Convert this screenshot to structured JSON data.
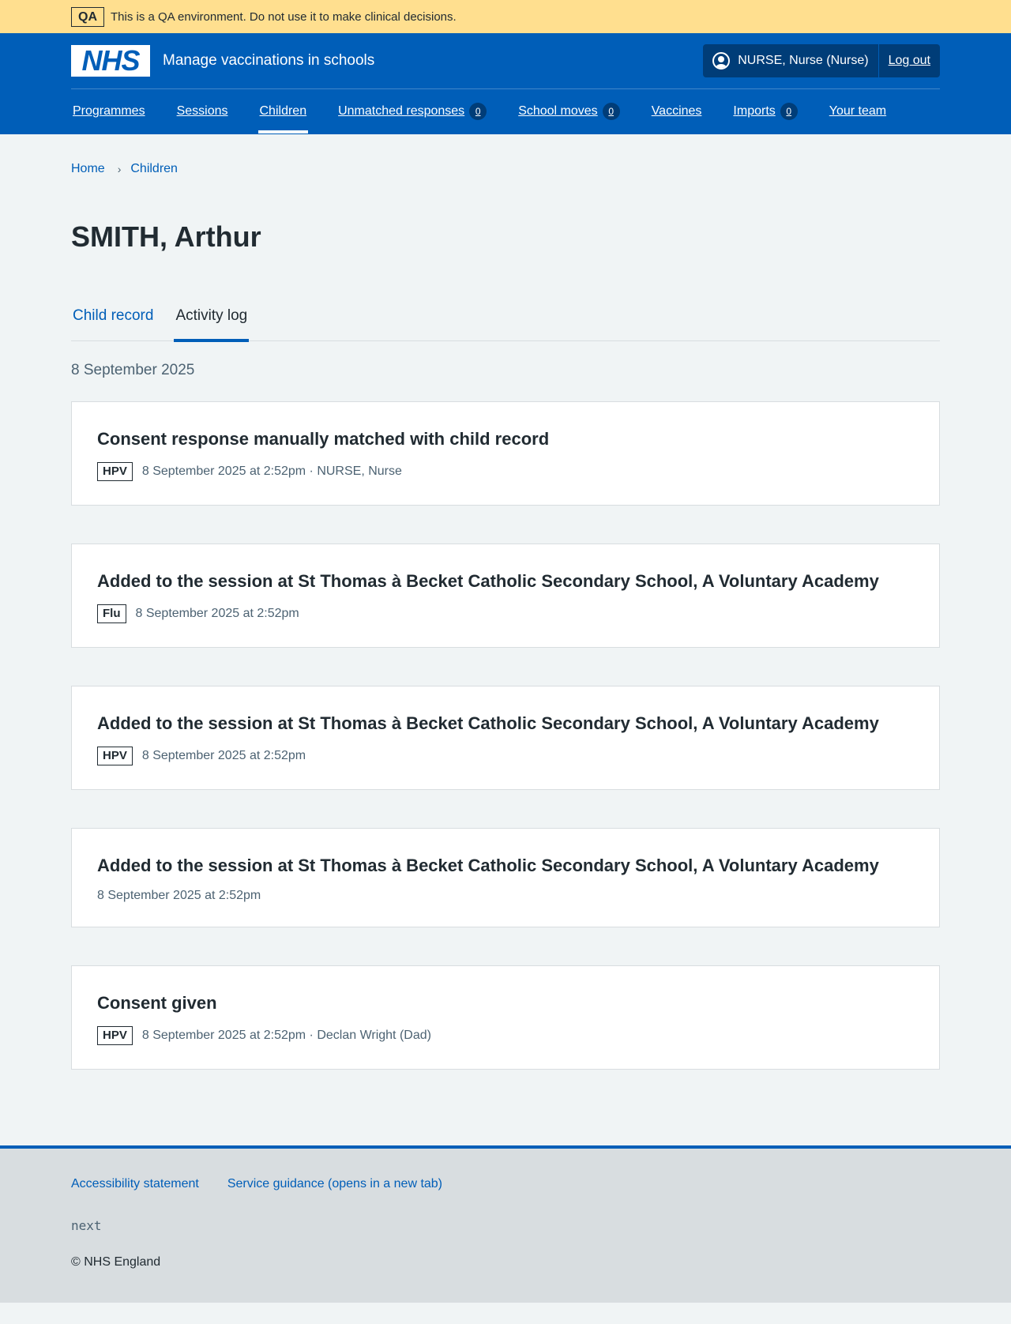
{
  "qa_banner": {
    "tag": "QA",
    "text": "This is a QA environment. Do not use it to make clinical decisions."
  },
  "header": {
    "logo_text": "NHS",
    "service_name": "Manage vaccinations in schools",
    "user_label": "NURSE, Nurse (Nurse)",
    "logout_label": "Log out"
  },
  "nav": {
    "programmes": "Programmes",
    "sessions": "Sessions",
    "children": "Children",
    "unmatched": "Unmatched responses",
    "unmatched_count": "0",
    "school_moves": "School moves",
    "school_moves_count": "0",
    "vaccines": "Vaccines",
    "imports": "Imports",
    "imports_count": "0",
    "your_team": "Your team"
  },
  "breadcrumb": {
    "home": "Home",
    "children": "Children"
  },
  "page_title": "SMITH, Arthur",
  "tabs": {
    "child_record": "Child record",
    "activity_log": "Activity log"
  },
  "date_heading": "8 September 2025",
  "events": [
    {
      "title": "Consent response manually matched with child record",
      "tag": "HPV",
      "meta": "8 September 2025 at 2:52pm · NURSE, Nurse"
    },
    {
      "title": "Added to the session at St Thomas à Becket Catholic Secondary School, A Voluntary Academy",
      "tag": "Flu",
      "meta": "8 September 2025 at 2:52pm"
    },
    {
      "title": "Added to the session at St Thomas à Becket Catholic Secondary School, A Voluntary Academy",
      "tag": "HPV",
      "meta": "8 September 2025 at 2:52pm"
    },
    {
      "title": "Added to the session at St Thomas à Becket Catholic Secondary School, A Voluntary Academy",
      "meta": "8 September 2025 at 2:52pm"
    },
    {
      "title": "Consent given",
      "tag": "HPV",
      "meta": "8 September 2025 at 2:52pm · Declan Wright (Dad)"
    }
  ],
  "footer": {
    "accessibility": "Accessibility statement",
    "guidance": "Service guidance (opens in a new tab)",
    "version": "next",
    "copyright": "© NHS England"
  },
  "colors": {
    "brand_blue": "#005eb8",
    "qa_yellow": "#ffdf8f",
    "page_bg": "#f0f4f5",
    "footer_bg": "#d8dde0"
  }
}
